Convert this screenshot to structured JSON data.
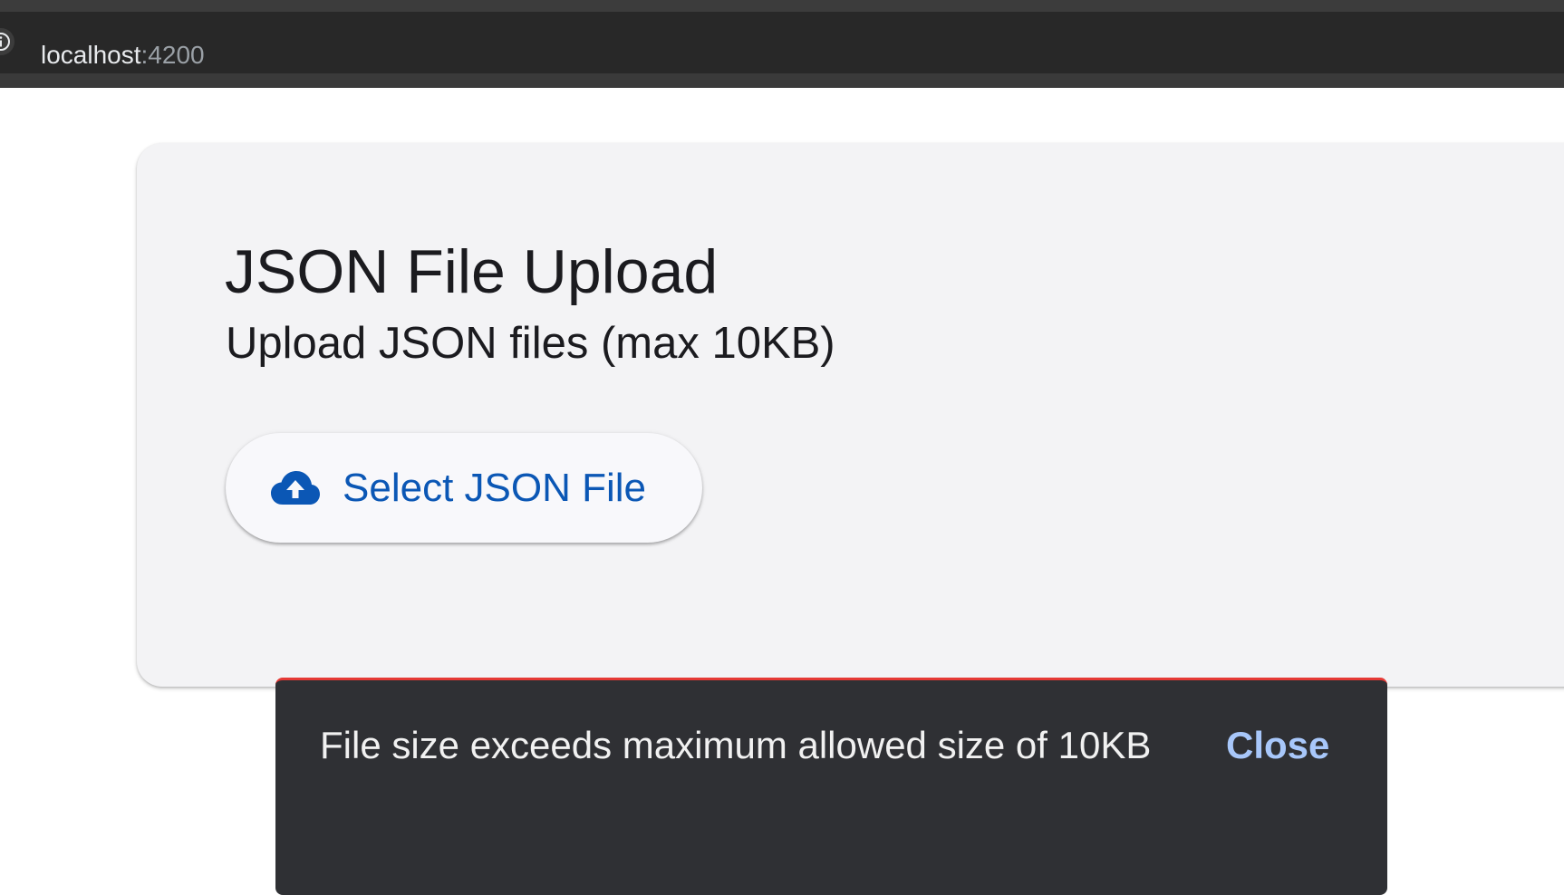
{
  "browser": {
    "url_host": "localhost",
    "url_port": ":4200",
    "site_info_icon": "info-icon"
  },
  "card": {
    "title": "JSON File Upload",
    "subtitle": "Upload JSON files (max 10KB)",
    "select_button": {
      "icon": "cloud-upload-icon",
      "label": "Select JSON File",
      "accent_color": "#0b57b5"
    }
  },
  "snackbar": {
    "message": "File size exceeds maximum allowed size of 10KB",
    "action_label": "Close",
    "status_color": "#e53935"
  }
}
